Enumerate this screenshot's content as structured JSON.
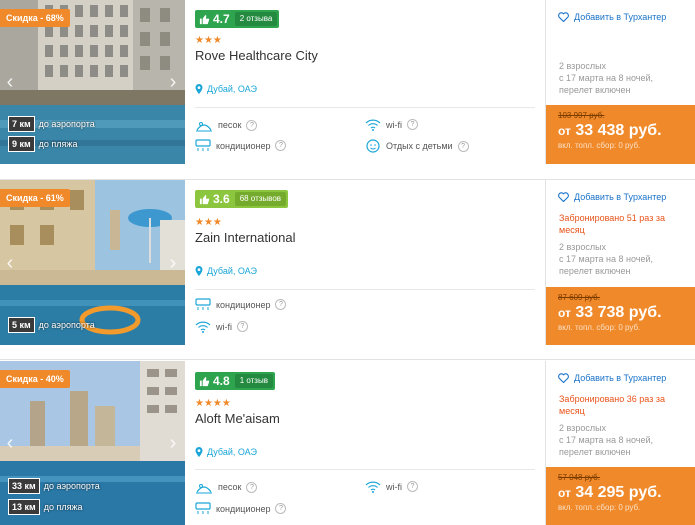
{
  "colors": {
    "accent": "#f0892a",
    "link": "#1a73c9",
    "location": "#1aa6d8",
    "booked": "#e8541a"
  },
  "hotels": [
    {
      "discount": "Скидка - 68%",
      "rating": {
        "score": "4.7",
        "reviews": "2 отзыва",
        "color": "#2ea44f"
      },
      "stars": "★★★",
      "name": "Rove Healthcare City",
      "location": "Дубай, ОАЭ",
      "distances": [
        {
          "km": "7 км",
          "label": "до аэропорта"
        },
        {
          "km": "9 км",
          "label": "до пляжа"
        }
      ],
      "amenities": [
        "песок",
        "wi-fi",
        "кондиционер",
        "Отдых с детьми"
      ],
      "favorite": "Добавить в Турхантер",
      "booked": "",
      "guests": "2 взрослых",
      "dates": "с 17 марта на 8 ночей,",
      "flight": "перелет включен",
      "old_price": "103 997 руб.",
      "price_prefix": "от",
      "price": "33 438 руб.",
      "fee": "вкл. топл. сбор: 0 руб."
    },
    {
      "discount": "Скидка - 61%",
      "rating": {
        "score": "3.6",
        "reviews": "68 отзывов",
        "color": "#8cc63f"
      },
      "stars": "★★★",
      "name": "Zain International",
      "location": "Дубай, ОАЭ",
      "distances": [
        {
          "km": "5 км",
          "label": "до аэропорта"
        }
      ],
      "amenities": [
        "кондиционер",
        "wi-fi"
      ],
      "favorite": "Добавить в Турхантер",
      "booked": "Забронировано 51 раз за месяц",
      "guests": "2 взрослых",
      "dates": "с 17 марта на 8 ночей,",
      "flight": "перелет включен",
      "old_price": "87 609 руб.",
      "price_prefix": "от",
      "price": "33 738 руб.",
      "fee": "вкл. топл. сбор: 0 руб."
    },
    {
      "discount": "Скидка - 40%",
      "rating": {
        "score": "4.8",
        "reviews": "1 отзыв",
        "color": "#2ea44f"
      },
      "stars": "★★★★",
      "name": "Aloft Me'aisam",
      "location": "Дубай, ОАЭ",
      "distances": [
        {
          "km": "33 км",
          "label": "до аэропорта"
        },
        {
          "km": "13 км",
          "label": "до пляжа"
        }
      ],
      "amenities": [
        "песок",
        "wi-fi",
        "кондиционер"
      ],
      "favorite": "Добавить в Турхантер",
      "booked": "Забронировано 36 раз за месяц",
      "guests": "2 взрослых",
      "dates": "с 17 марта на 8 ночей,",
      "flight": "перелет включен",
      "old_price": "57 048 руб.",
      "price_prefix": "от",
      "price": "34 295 руб.",
      "fee": "вкл. топл. сбор: 0 руб."
    }
  ]
}
